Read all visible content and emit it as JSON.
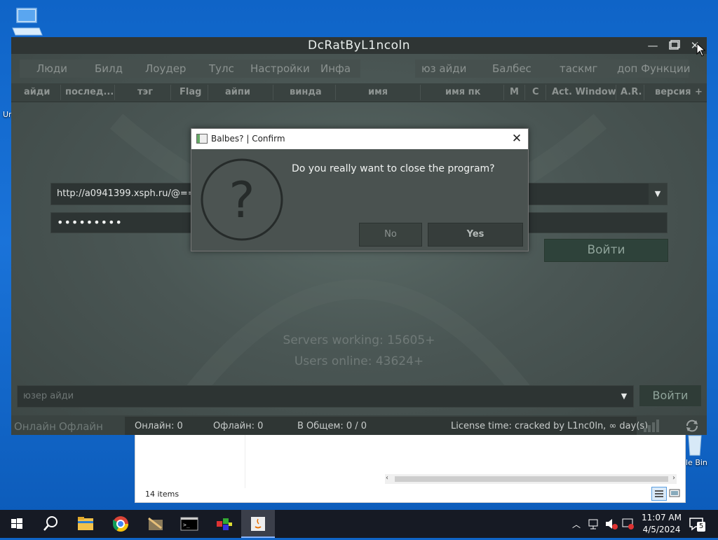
{
  "desktop": {
    "recycle_bin_label": "le Bin",
    "left_label": "Ur"
  },
  "explorer": {
    "status": "14 items"
  },
  "app": {
    "title": "DcRatByL1ncoln",
    "menu": [
      "Люди",
      "Билд",
      "Лоудер",
      "Тулс",
      "Настройки",
      "Инфа",
      "юз айди",
      "Балбес",
      "таскмг",
      "доп Функции"
    ],
    "columns": [
      "айди",
      "послед...",
      "тэг",
      "Flag",
      "айпи",
      "винда",
      "имя",
      "имя пк",
      "M",
      "C",
      "Act. Window",
      "A.R.",
      "версия",
      "+"
    ],
    "login": {
      "url_value": "http://a0941399.xsph.ru/@==gbJ",
      "password_mask": "•••••••••",
      "login_button": "Войти"
    },
    "stats": {
      "servers": "Servers working: 15605+",
      "users": "Users online: 43624+"
    },
    "userid": {
      "placeholder": "юзер айди",
      "login_button": "Войти"
    },
    "statusbar": {
      "tab_online": "Онлайн",
      "tab_offline": "Офлайн",
      "online": "Онлайн: 0",
      "offline": "Офлайн: 0",
      "total": "В Общем: 0 / 0",
      "license": "License time: cracked by L1nc0ln, ∞ day(s)"
    }
  },
  "dialog": {
    "title": "Balbes? | Confirm",
    "message": "Do you really want to close the program?",
    "no_label": "No",
    "yes_label": "Yes"
  },
  "taskbar": {
    "time": "11:07 AM",
    "date": "4/5/2024",
    "notification_count": "5"
  },
  "colors": {
    "desktop": "#1a73d9",
    "app_bg": "#4a5654",
    "login_green": "#2e423a",
    "taskbar": "#161a24"
  }
}
